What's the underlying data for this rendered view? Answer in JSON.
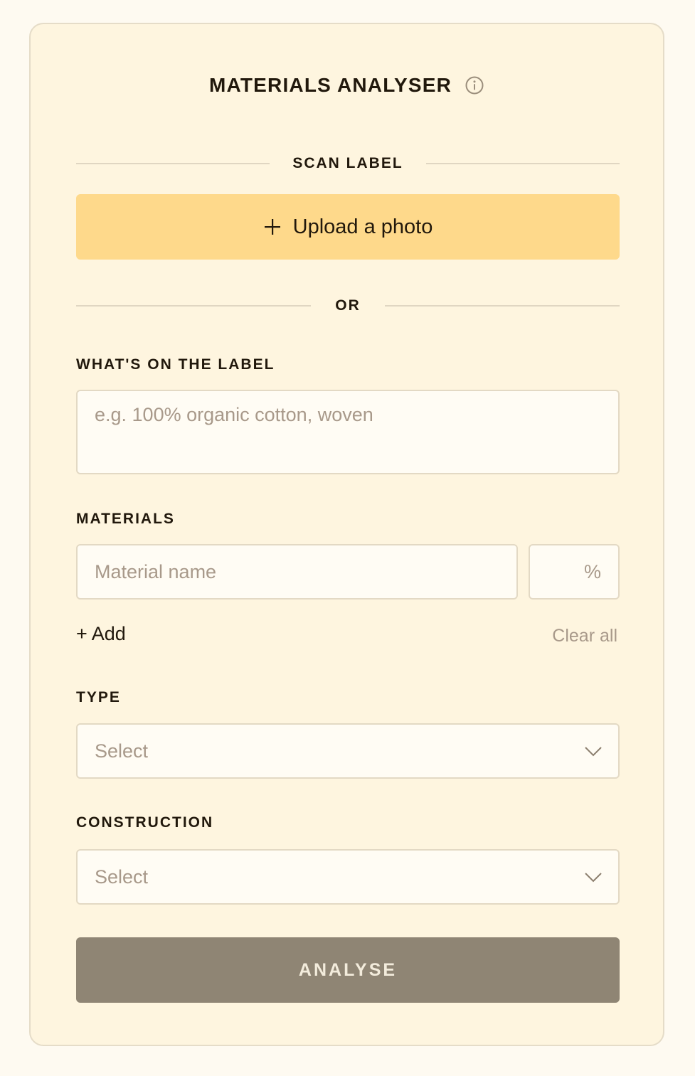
{
  "header": {
    "title": "MATERIALS ANALYSER",
    "info_icon": "info-circle-icon"
  },
  "scan": {
    "section_label": "SCAN LABEL",
    "upload_label": "Upload a photo",
    "upload_icon": "plus-icon"
  },
  "or_label": "OR",
  "label_text": {
    "label": "WHAT'S ON THE LABEL",
    "placeholder": "e.g. 100% organic cotton, woven"
  },
  "materials": {
    "label": "MATERIALS",
    "name_placeholder": "Material name",
    "percent_placeholder": "%",
    "add_label": "+ Add",
    "clear_label": "Clear all"
  },
  "type": {
    "label": "TYPE",
    "selected": "Select",
    "icon": "chevron-down-icon"
  },
  "construction": {
    "label": "CONSTRUCTION",
    "selected": "Select",
    "icon": "chevron-down-icon"
  },
  "analyse_label": "ANALYSE",
  "colors": {
    "page_bg": "#fefaf1",
    "card_bg": "#fef5df",
    "upload_bg": "#fed98b",
    "analyse_bg": "#8f8574",
    "text_dark": "#21180c",
    "placeholder": "#a8998a"
  }
}
